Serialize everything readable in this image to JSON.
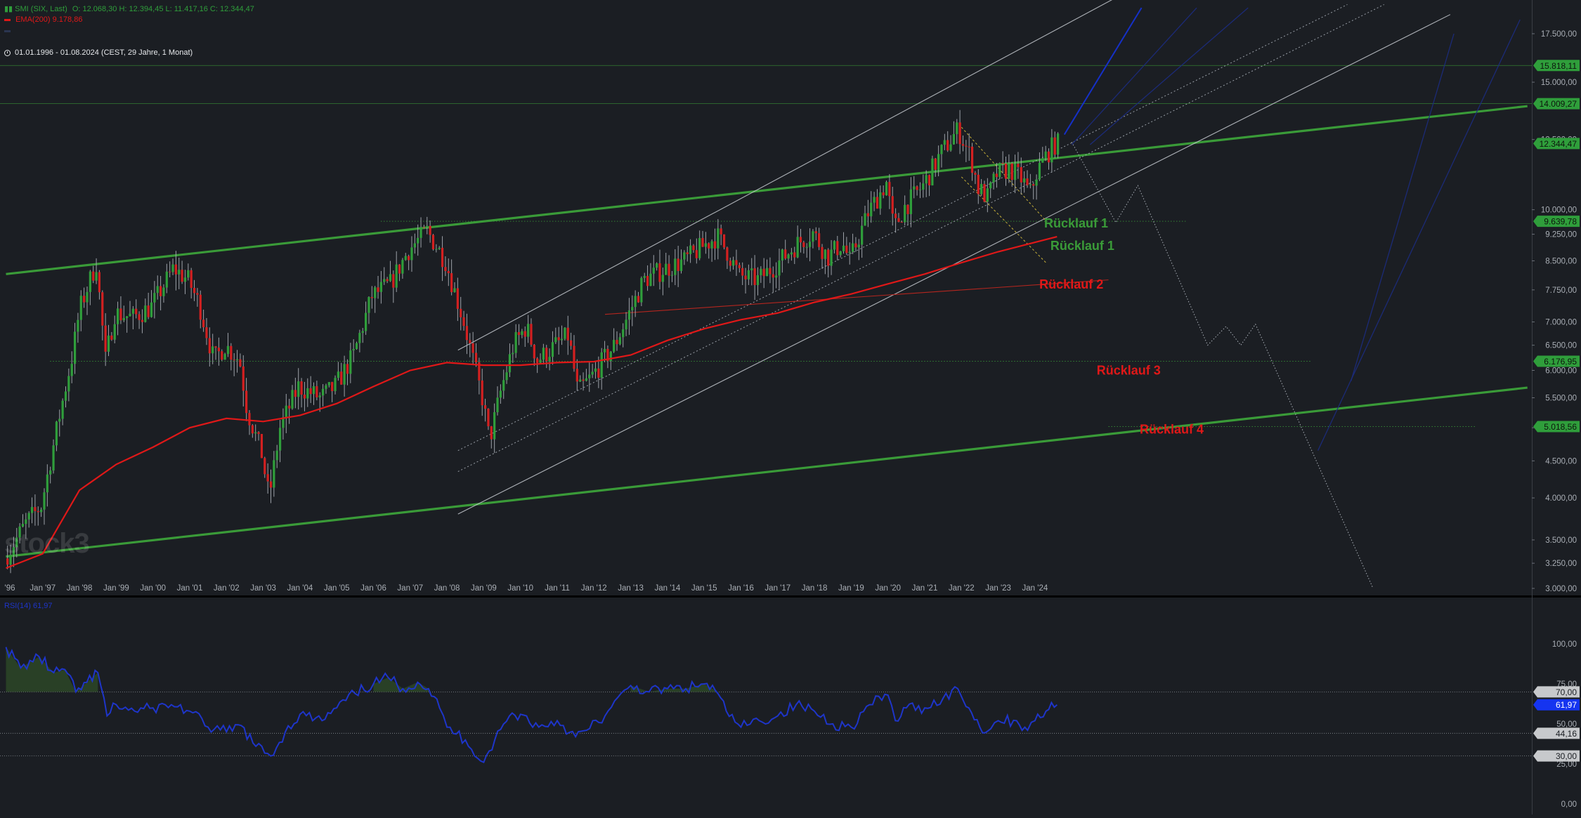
{
  "header": {
    "instrument": "SMI (SIX, Last)",
    "ohlc": "O: 12.068,30  H: 12.394,45  L: 11.417,16  C: 12.344,47",
    "ema_label": "EMA(200)  9.178,86",
    "third_label": "",
    "date_range": "01.01.1996 - 01.08.2024  (CEST, 29 Jahre, 1 Monat)",
    "watermark": "stock3"
  },
  "colors": {
    "background": "#1b1e23",
    "up_candle": "#2f9e3b",
    "down_candle": "#d32020",
    "ema": "#e01818",
    "trend_green": "#3a9b38",
    "rsi": "#1e35c9",
    "annotation_green": "#3a9b38",
    "annotation_red": "#e01818"
  },
  "chart_data": [
    {
      "type": "candlestick",
      "title": "SMI (SIX, Last)",
      "interval": "1 Monat",
      "y_scale": "log",
      "ylim": [
        3000,
        18500
      ],
      "x_tick_labels": [
        "'96",
        "Jan '97",
        "Jan '98",
        "Jan '99",
        "Jan '00",
        "Jan '01",
        "Jan '02",
        "Jan '03",
        "Jan '04",
        "Jan '05",
        "Jan '06",
        "Jan '07",
        "Jan '08",
        "Jan '09",
        "Jan '10",
        "Jan '11",
        "Jan '12",
        "Jan '13",
        "Jan '14",
        "Jan '15",
        "Jan '16",
        "Jan '17",
        "Jan '18",
        "Jan '19",
        "Jan '20",
        "Jan '21",
        "Jan '22",
        "Jan '23",
        "Jan '24"
      ],
      "y_tick_labels": [
        "17.500,00",
        "15.000,00",
        "12.500,00",
        "10.000,00",
        "9.250,00",
        "8.500,00",
        "7.750,00",
        "7.000,00",
        "6.500,00",
        "6.000,00",
        "5.500,00",
        "5.000,00",
        "4.500,00",
        "4.000,00",
        "3.500,00",
        "3.250,00",
        "3.000,00"
      ],
      "price_path": [
        {
          "t": 1996.0,
          "v": 3300
        },
        {
          "t": 1996.6,
          "v": 3700
        },
        {
          "t": 1997.0,
          "v": 3900
        },
        {
          "t": 1997.5,
          "v": 5200
        },
        {
          "t": 1997.85,
          "v": 6300
        },
        {
          "t": 1998.05,
          "v": 7300
        },
        {
          "t": 1998.5,
          "v": 8450
        },
        {
          "t": 1998.75,
          "v": 6200
        },
        {
          "t": 1999.0,
          "v": 7200
        },
        {
          "t": 1999.5,
          "v": 7100
        },
        {
          "t": 2000.0,
          "v": 7350
        },
        {
          "t": 2000.6,
          "v": 8300
        },
        {
          "t": 2001.0,
          "v": 8000
        },
        {
          "t": 2001.3,
          "v": 7400
        },
        {
          "t": 2001.7,
          "v": 6200
        },
        {
          "t": 2002.0,
          "v": 6500
        },
        {
          "t": 2002.4,
          "v": 6200
        },
        {
          "t": 2002.6,
          "v": 5300
        },
        {
          "t": 2003.0,
          "v": 4600
        },
        {
          "t": 2003.2,
          "v": 4000
        },
        {
          "t": 2003.5,
          "v": 5000
        },
        {
          "t": 2004.0,
          "v": 5700
        },
        {
          "t": 2004.6,
          "v": 5500
        },
        {
          "t": 2005.0,
          "v": 5700
        },
        {
          "t": 2005.5,
          "v": 6300
        },
        {
          "t": 2006.0,
          "v": 7600
        },
        {
          "t": 2006.5,
          "v": 7900
        },
        {
          "t": 2007.0,
          "v": 8800
        },
        {
          "t": 2007.5,
          "v": 9350
        },
        {
          "t": 2008.0,
          "v": 8500
        },
        {
          "t": 2008.5,
          "v": 7000
        },
        {
          "t": 2009.0,
          "v": 5500
        },
        {
          "t": 2009.2,
          "v": 4800
        },
        {
          "t": 2009.5,
          "v": 5600
        },
        {
          "t": 2009.85,
          "v": 6500
        },
        {
          "t": 2010.2,
          "v": 6900
        },
        {
          "t": 2010.5,
          "v": 6200
        },
        {
          "t": 2011.0,
          "v": 6500
        },
        {
          "t": 2011.35,
          "v": 6700
        },
        {
          "t": 2011.6,
          "v": 5600
        },
        {
          "t": 2012.0,
          "v": 5900
        },
        {
          "t": 2012.3,
          "v": 6200
        },
        {
          "t": 2012.6,
          "v": 6500
        },
        {
          "t": 2013.0,
          "v": 7200
        },
        {
          "t": 2013.4,
          "v": 8000
        },
        {
          "t": 2014.0,
          "v": 8300
        },
        {
          "t": 2014.5,
          "v": 8500
        },
        {
          "t": 2015.0,
          "v": 8900
        },
        {
          "t": 2015.4,
          "v": 9200
        },
        {
          "t": 2015.7,
          "v": 8700
        },
        {
          "t": 2016.0,
          "v": 8100
        },
        {
          "t": 2016.5,
          "v": 8000
        },
        {
          "t": 2017.0,
          "v": 8400
        },
        {
          "t": 2017.6,
          "v": 9000
        },
        {
          "t": 2018.0,
          "v": 9300
        },
        {
          "t": 2018.4,
          "v": 8600
        },
        {
          "t": 2018.8,
          "v": 9000
        },
        {
          "t": 2019.0,
          "v": 8500
        },
        {
          "t": 2019.5,
          "v": 9900
        },
        {
          "t": 2020.0,
          "v": 10900
        },
        {
          "t": 2020.2,
          "v": 9400
        },
        {
          "t": 2020.5,
          "v": 10100
        },
        {
          "t": 2021.0,
          "v": 10800
        },
        {
          "t": 2021.5,
          "v": 12000
        },
        {
          "t": 2021.95,
          "v": 12900
        },
        {
          "t": 2022.3,
          "v": 11800
        },
        {
          "t": 2022.5,
          "v": 10700
        },
        {
          "t": 2022.75,
          "v": 10400
        },
        {
          "t": 2023.0,
          "v": 11200
        },
        {
          "t": 2023.35,
          "v": 11400
        },
        {
          "t": 2023.7,
          "v": 11000
        },
        {
          "t": 2023.9,
          "v": 10500
        },
        {
          "t": 2024.1,
          "v": 11300
        },
        {
          "t": 2024.4,
          "v": 12000
        },
        {
          "t": 2024.6,
          "v": 12344
        }
      ],
      "ema200_path": [
        {
          "t": 1996.0,
          "v": 3200
        },
        {
          "t": 1997.0,
          "v": 3350
        },
        {
          "t": 1998.0,
          "v": 4100
        },
        {
          "t": 1999.0,
          "v": 4450
        },
        {
          "t": 2000.0,
          "v": 4700
        },
        {
          "t": 2001.0,
          "v": 5000
        },
        {
          "t": 2002.0,
          "v": 5150
        },
        {
          "t": 2003.0,
          "v": 5100
        },
        {
          "t": 2004.0,
          "v": 5200
        },
        {
          "t": 2005.0,
          "v": 5400
        },
        {
          "t": 2006.0,
          "v": 5700
        },
        {
          "t": 2007.0,
          "v": 6000
        },
        {
          "t": 2008.0,
          "v": 6150
        },
        {
          "t": 2009.0,
          "v": 6100
        },
        {
          "t": 2010.0,
          "v": 6100
        },
        {
          "t": 2011.0,
          "v": 6150
        },
        {
          "t": 2012.0,
          "v": 6170
        },
        {
          "t": 2013.0,
          "v": 6300
        },
        {
          "t": 2014.0,
          "v": 6600
        },
        {
          "t": 2015.0,
          "v": 6850
        },
        {
          "t": 2016.0,
          "v": 7050
        },
        {
          "t": 2017.0,
          "v": 7200
        },
        {
          "t": 2018.0,
          "v": 7450
        },
        {
          "t": 2019.0,
          "v": 7650
        },
        {
          "t": 2020.0,
          "v": 7900
        },
        {
          "t": 2021.0,
          "v": 8150
        },
        {
          "t": 2022.0,
          "v": 8450
        },
        {
          "t": 2023.0,
          "v": 8750
        },
        {
          "t": 2024.6,
          "v": 9178
        }
      ],
      "price_badges": [
        {
          "label": "15.818,11",
          "value": 15818.11
        },
        {
          "label": "14.009,27",
          "value": 14009.27
        },
        {
          "label": "12.344,47",
          "value": 12344.47
        },
        {
          "label": "9.639,78",
          "value": 9639.78
        },
        {
          "label": "6.176,95",
          "value": 6176.95
        },
        {
          "label": "5.018,56",
          "value": 5018.56
        }
      ],
      "annotations": [
        {
          "text": "Rücklauf 1",
          "color": "green",
          "t": 2024.25,
          "v": 9450
        },
        {
          "text": "Rücklauf 1",
          "color": "green",
          "t": 2024.42,
          "v": 8800
        },
        {
          "text": "Rücklauf 2",
          "color": "red",
          "t": 2024.12,
          "v": 7780
        },
        {
          "text": "Rücklauf 3",
          "color": "red",
          "t": 2025.68,
          "v": 5920
        },
        {
          "text": "Rücklauf 4",
          "color": "red",
          "t": 2026.85,
          "v": 4910
        }
      ],
      "lines": [
        {
          "kind": "trend",
          "color": "green",
          "from": {
            "t": 1996.0,
            "v": 8150
          },
          "to": {
            "t": 2037.4,
            "v": 13900
          }
        },
        {
          "kind": "trend",
          "color": "green",
          "from": {
            "t": 1996.0,
            "v": 3320
          },
          "to": {
            "t": 2037.4,
            "v": 5680
          }
        },
        {
          "kind": "horizontal-thin",
          "color": "green",
          "v": 15818.11
        },
        {
          "kind": "horizontal-thin",
          "color": "green",
          "v": 14009.27
        },
        {
          "kind": "horizontal-dotted",
          "color": "green",
          "v": 9639.78,
          "from": 2006.2,
          "to": 2028.1
        },
        {
          "kind": "horizontal-dotted",
          "color": "green",
          "v": 6176.95,
          "from": 1997.2,
          "to": 2031.5
        },
        {
          "kind": "horizontal-dotted",
          "color": "green",
          "v": 5018.56,
          "from": 2026.0,
          "to": 2036.0
        },
        {
          "kind": "channel",
          "color": "white",
          "from": {
            "t": 2008.3,
            "v": 6400
          },
          "to": {
            "t": 2026.1,
            "v": 19500
          }
        },
        {
          "kind": "channel",
          "color": "white",
          "from": {
            "t": 2008.3,
            "v": 3800
          },
          "to": {
            "t": 2035.3,
            "v": 18600
          }
        },
        {
          "kind": "channel-dotted",
          "color": "white",
          "from": {
            "t": 2008.3,
            "v": 4650
          },
          "to": {
            "t": 2032.5,
            "v": 19200
          }
        },
        {
          "kind": "channel-dotted",
          "color": "white",
          "from": {
            "t": 2008.3,
            "v": 4350
          },
          "to": {
            "t": 2033.5,
            "v": 19200
          }
        },
        {
          "kind": "support",
          "color": "red",
          "from": {
            "t": 2012.3,
            "v": 7170
          },
          "to": {
            "t": 2026.0,
            "v": 8000
          }
        },
        {
          "kind": "wedge",
          "color": "yellow",
          "from": {
            "t": 2022.0,
            "v": 13000
          },
          "to": {
            "t": 2024.3,
            "v": 9650
          }
        },
        {
          "kind": "wedge",
          "color": "yellow",
          "from": {
            "t": 2022.0,
            "v": 11100
          },
          "to": {
            "t": 2024.3,
            "v": 8450
          }
        }
      ],
      "projection_path": [
        {
          "t": 2025.0,
          "v": 12400
        },
        {
          "t": 2026.2,
          "v": 9600
        },
        {
          "t": 2026.8,
          "v": 10800
        },
        {
          "t": 2028.7,
          "v": 6500
        },
        {
          "t": 2029.2,
          "v": 6900
        },
        {
          "t": 2029.6,
          "v": 6500
        },
        {
          "t": 2030.0,
          "v": 6950
        },
        {
          "t": 2033.2,
          "v": 3000
        }
      ],
      "blue_lines": [
        {
          "from": {
            "t": 2024.8,
            "v": 12700
          },
          "to": {
            "t": 2026.9,
            "v": 19000
          }
        },
        {
          "from": {
            "t": 2025.0,
            "v": 12300
          },
          "to": {
            "t": 2028.4,
            "v": 19000
          }
        },
        {
          "from": {
            "t": 2025.5,
            "v": 12300
          },
          "to": {
            "t": 2029.8,
            "v": 19000
          }
        },
        {
          "from": {
            "t": 2031.7,
            "v": 4650
          },
          "to": {
            "t": 2037.2,
            "v": 18300
          }
        },
        {
          "from": {
            "t": 2032.6,
            "v": 5800
          },
          "to": {
            "t": 2035.4,
            "v": 17500
          }
        }
      ]
    },
    {
      "type": "line",
      "title": "RSI(14)",
      "value_label": "RSI(14)  61,97",
      "current_value": 61.97,
      "ylim": [
        0,
        100
      ],
      "y_tick_labels": [
        "100,00",
        "75,00",
        "50,00",
        "25,00",
        "0,00"
      ],
      "levels": [
        {
          "label": "70,00",
          "value": 70
        },
        {
          "label": "61,97",
          "value": 61.97
        },
        {
          "label": "44,16",
          "value": 44.16
        },
        {
          "label": "30,00",
          "value": 30
        }
      ],
      "rsi_path": [
        {
          "t": 1996.0,
          "v": 98
        },
        {
          "t": 1996.4,
          "v": 85
        },
        {
          "t": 1996.9,
          "v": 92
        },
        {
          "t": 1997.3,
          "v": 82
        },
        {
          "t": 1997.6,
          "v": 84
        },
        {
          "t": 1997.9,
          "v": 70
        },
        {
          "t": 1998.2,
          "v": 76
        },
        {
          "t": 1998.5,
          "v": 82
        },
        {
          "t": 1998.75,
          "v": 55
        },
        {
          "t": 1999.0,
          "v": 62
        },
        {
          "t": 1999.5,
          "v": 58
        },
        {
          "t": 2000.0,
          "v": 60
        },
        {
          "t": 2000.5,
          "v": 62
        },
        {
          "t": 2001.0,
          "v": 58
        },
        {
          "t": 2001.5,
          "v": 48
        },
        {
          "t": 2002.0,
          "v": 45
        },
        {
          "t": 2002.4,
          "v": 49
        },
        {
          "t": 2002.8,
          "v": 36
        },
        {
          "t": 2003.2,
          "v": 30
        },
        {
          "t": 2003.6,
          "v": 45
        },
        {
          "t": 2004.0,
          "v": 56
        },
        {
          "t": 2004.6,
          "v": 52
        },
        {
          "t": 2005.0,
          "v": 60
        },
        {
          "t": 2005.5,
          "v": 69
        },
        {
          "t": 2006.0,
          "v": 75
        },
        {
          "t": 2006.4,
          "v": 79
        },
        {
          "t": 2006.8,
          "v": 72
        },
        {
          "t": 2007.2,
          "v": 76
        },
        {
          "t": 2007.5,
          "v": 72
        },
        {
          "t": 2007.8,
          "v": 60
        },
        {
          "t": 2008.0,
          "v": 48
        },
        {
          "t": 2008.5,
          "v": 40
        },
        {
          "t": 2009.0,
          "v": 26
        },
        {
          "t": 2009.3,
          "v": 40
        },
        {
          "t": 2009.7,
          "v": 55
        },
        {
          "t": 2010.0,
          "v": 56
        },
        {
          "t": 2010.5,
          "v": 48
        },
        {
          "t": 2011.0,
          "v": 52
        },
        {
          "t": 2011.5,
          "v": 42
        },
        {
          "t": 2011.8,
          "v": 46
        },
        {
          "t": 2012.3,
          "v": 55
        },
        {
          "t": 2013.0,
          "v": 74
        },
        {
          "t": 2013.5,
          "v": 70
        },
        {
          "t": 2014.0,
          "v": 72
        },
        {
          "t": 2014.5,
          "v": 72
        },
        {
          "t": 2015.0,
          "v": 75
        },
        {
          "t": 2015.3,
          "v": 71
        },
        {
          "t": 2015.6,
          "v": 58
        },
        {
          "t": 2016.0,
          "v": 48
        },
        {
          "t": 2016.5,
          "v": 52
        },
        {
          "t": 2017.0,
          "v": 55
        },
        {
          "t": 2017.5,
          "v": 62
        },
        {
          "t": 2018.0,
          "v": 58
        },
        {
          "t": 2018.5,
          "v": 50
        },
        {
          "t": 2019.0,
          "v": 48
        },
        {
          "t": 2019.5,
          "v": 62
        },
        {
          "t": 2020.0,
          "v": 68
        },
        {
          "t": 2020.2,
          "v": 52
        },
        {
          "t": 2020.5,
          "v": 60
        },
        {
          "t": 2021.0,
          "v": 60
        },
        {
          "t": 2021.5,
          "v": 66
        },
        {
          "t": 2021.9,
          "v": 72
        },
        {
          "t": 2022.2,
          "v": 60
        },
        {
          "t": 2022.5,
          "v": 48
        },
        {
          "t": 2022.8,
          "v": 47
        },
        {
          "t": 2023.0,
          "v": 52
        },
        {
          "t": 2023.5,
          "v": 52
        },
        {
          "t": 2023.8,
          "v": 46
        },
        {
          "t": 2024.0,
          "v": 52
        },
        {
          "t": 2024.3,
          "v": 58
        },
        {
          "t": 2024.6,
          "v": 61.97
        }
      ]
    }
  ]
}
